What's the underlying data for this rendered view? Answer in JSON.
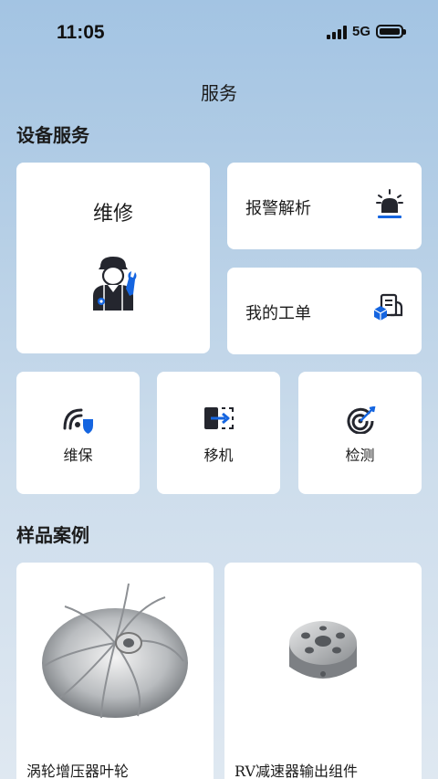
{
  "status": {
    "time": "11:05",
    "network": "5G"
  },
  "page": {
    "title": "服务"
  },
  "equipment_section": {
    "title": "设备服务",
    "repair": {
      "label": "维修",
      "icon": "mechanic-icon"
    },
    "alarm": {
      "label": "报警解析",
      "icon": "alarm-light-icon"
    },
    "workorder": {
      "label": "我的工单",
      "icon": "work-order-icon"
    },
    "maintenance": {
      "label": "维保",
      "icon": "shield-signal-icon"
    },
    "relocate": {
      "label": "移机",
      "icon": "move-machine-icon"
    },
    "inspect": {
      "label": "检测",
      "icon": "target-detect-icon"
    }
  },
  "samples_section": {
    "title": "样品案例",
    "items": [
      {
        "label": "涡轮增压器叶轮"
      },
      {
        "label": "RV减速器输出组件"
      }
    ]
  },
  "colors": {
    "accent": "#1565e0",
    "dark": "#24262e"
  }
}
